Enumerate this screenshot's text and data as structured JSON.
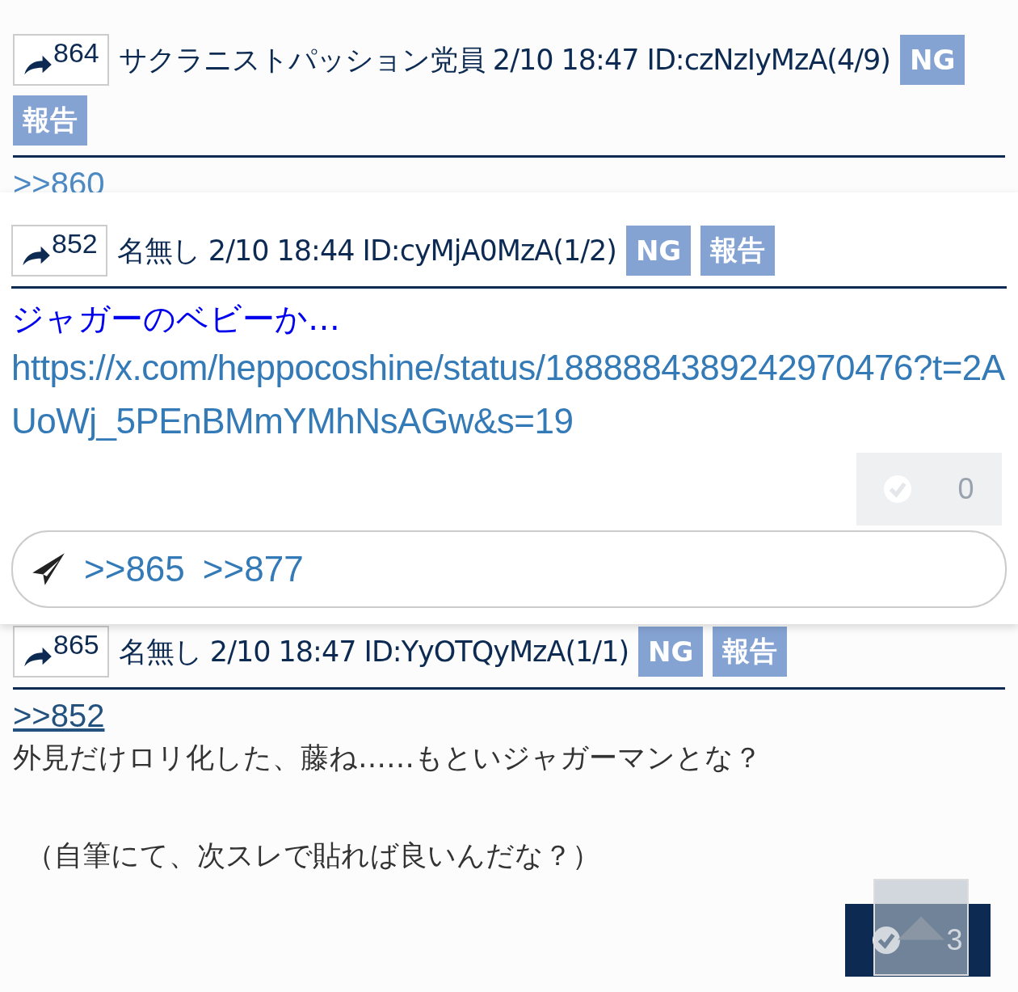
{
  "posts": [
    {
      "number": "864",
      "meta": "サクラニストパッション党員 2/10 18:47 ID:czNzIyMzA(4/9)",
      "ng": "NG",
      "report": "報告",
      "anchor": ">>860"
    },
    {
      "number": "865",
      "meta": "名無し 2/10 18:47 ID:YyOTQyMzA(1/1)",
      "ng": "NG",
      "report": "報告",
      "anchor": ">>852",
      "body": [
        "外見だけロリ化した、藤ね……もといジャガーマンとな？",
        "（自筆にて、次スレで貼れば良いんだな？）"
      ],
      "likes": "3"
    }
  ],
  "popup": {
    "number": "852",
    "meta": "名無し 2/10 18:44 ID:cyMjA0MzA(1/2)",
    "ng": "NG",
    "report": "報告",
    "text": "ジャガーのベビーか…",
    "link": "https://x.com/heppocoshine/status/1888884389242970476?t=2AUoWj_5PEnBMmYMhNsAGw&s=19",
    "likes": "0",
    "replies": [
      ">>865",
      ">>877"
    ]
  }
}
